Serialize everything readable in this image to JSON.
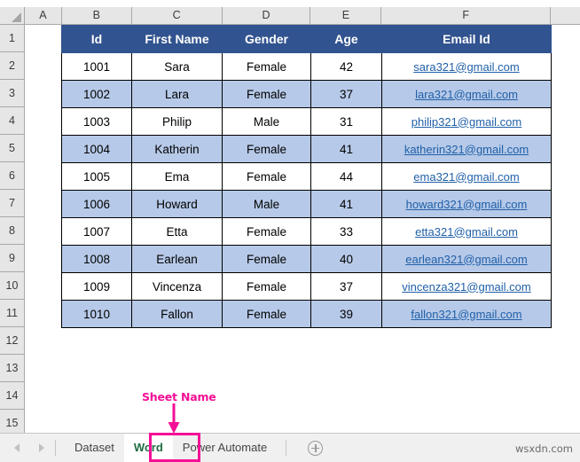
{
  "spreadsheet": {
    "column_headers": [
      "A",
      "B",
      "C",
      "D",
      "E",
      "F"
    ],
    "row_numbers": [
      "1",
      "2",
      "3",
      "4",
      "5",
      "6",
      "7",
      "8",
      "9",
      "10",
      "11",
      "12",
      "13",
      "14",
      "15"
    ],
    "table": {
      "headers": [
        "Id",
        "First Name",
        "Gender",
        "Age",
        "Email Id"
      ],
      "rows": [
        {
          "id": "1001",
          "first_name": "Sara",
          "gender": "Female",
          "age": "42",
          "email": "sara321@gmail.com"
        },
        {
          "id": "1002",
          "first_name": "Lara",
          "gender": "Female",
          "age": "37",
          "email": "lara321@gmail.com"
        },
        {
          "id": "1003",
          "first_name": "Philip",
          "gender": "Male",
          "age": "31",
          "email": "philip321@gmail.com"
        },
        {
          "id": "1004",
          "first_name": "Katherin",
          "gender": "Female",
          "age": "41",
          "email": "katherin321@gmail.com"
        },
        {
          "id": "1005",
          "first_name": "Ema",
          "gender": "Female",
          "age": "44",
          "email": "ema321@gmail.com"
        },
        {
          "id": "1006",
          "first_name": "Howard",
          "gender": "Male",
          "age": "41",
          "email": "howard321@gmail.com"
        },
        {
          "id": "1007",
          "first_name": "Etta",
          "gender": "Female",
          "age": "33",
          "email": "etta321@gmail.com"
        },
        {
          "id": "1008",
          "first_name": "Earlean",
          "gender": "Female",
          "age": "40",
          "email": "earlean321@gmail.com"
        },
        {
          "id": "1009",
          "first_name": "Vincenza",
          "gender": "Female",
          "age": "37",
          "email": "vincenza321@gmail.com"
        },
        {
          "id": "1010",
          "first_name": "Fallon",
          "gender": "Female",
          "age": "39",
          "email": "fallon321@gmail.com"
        }
      ]
    }
  },
  "annotation": {
    "label": "Sheet Name",
    "color": "#f50f96"
  },
  "tab_bar": {
    "prev_icon": "triangle-left-icon",
    "next_icon": "triangle-right-icon",
    "tabs": [
      {
        "label": "Dataset",
        "active": false
      },
      {
        "label": "Word",
        "active": true
      },
      {
        "label": "Power Automate",
        "active": false
      }
    ],
    "add_sheet_icon": "plus-circle-icon"
  },
  "watermark": {
    "text": "wsxdn.com"
  },
  "colors": {
    "header_fill": "#31538f",
    "banded_row": "#b6c9e8",
    "link": "#2060a8",
    "active_tab_text": "#1d6b42",
    "annotation": "#f50f96"
  }
}
